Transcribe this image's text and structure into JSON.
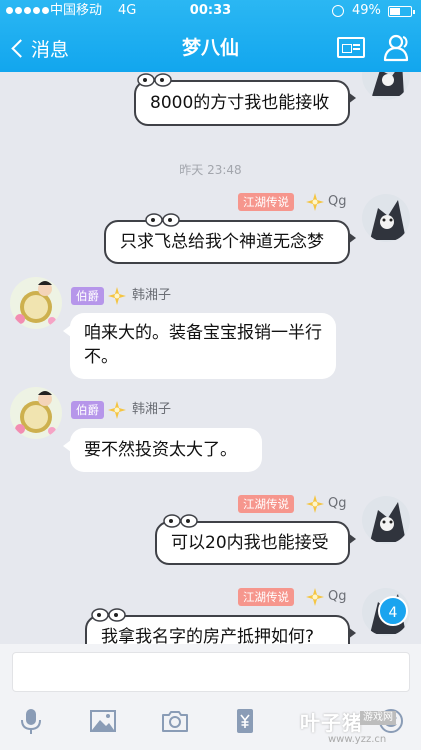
{
  "status_bar": {
    "carrier": "中国移动",
    "network": "4G",
    "time": "00:33",
    "battery_percent_text": "49%",
    "battery_level": 0.49
  },
  "nav": {
    "back_label": "消息",
    "title": "梦八仙"
  },
  "chat": {
    "timestamp": "昨天 23:48",
    "messages": [
      {
        "side": "right",
        "badge": "",
        "sender": "",
        "text": "8000的方寸我也能接收"
      },
      {
        "side": "right",
        "badge": "江湖传说",
        "sender": "Qg",
        "text": "只求飞总给我个神道无念梦"
      },
      {
        "side": "left",
        "badge": "伯爵",
        "sender": "韩湘子",
        "text": "咱来大的。装备宝宝报销一半行不。"
      },
      {
        "side": "left",
        "badge": "伯爵",
        "sender": "韩湘子",
        "text": "要不然投资太大了。"
      },
      {
        "side": "right",
        "badge": "江湖传说",
        "sender": "Qg",
        "text": "可以20内我也能接受"
      },
      {
        "side": "right",
        "badge": "江湖传说",
        "sender": "Qg",
        "text": "我拿我名字的房产抵押如何?"
      }
    ],
    "unread_count": "4"
  },
  "input": {
    "value": "",
    "placeholder": ""
  },
  "toolbar": {
    "icons": [
      "microphone-icon",
      "image-icon",
      "camera-icon",
      "red-packet-icon",
      "emoji-icon"
    ]
  },
  "watermark": {
    "main": "叶子猪",
    "tag": "游戏网",
    "url": "www.yzz.cn"
  },
  "colors": {
    "nav_bar": "#12a6ee",
    "badge_orange": "#f6968d",
    "badge_purple": "#b696ea",
    "unread_badge": "#1aa4ef",
    "chat_background": "#e6e8ee"
  }
}
